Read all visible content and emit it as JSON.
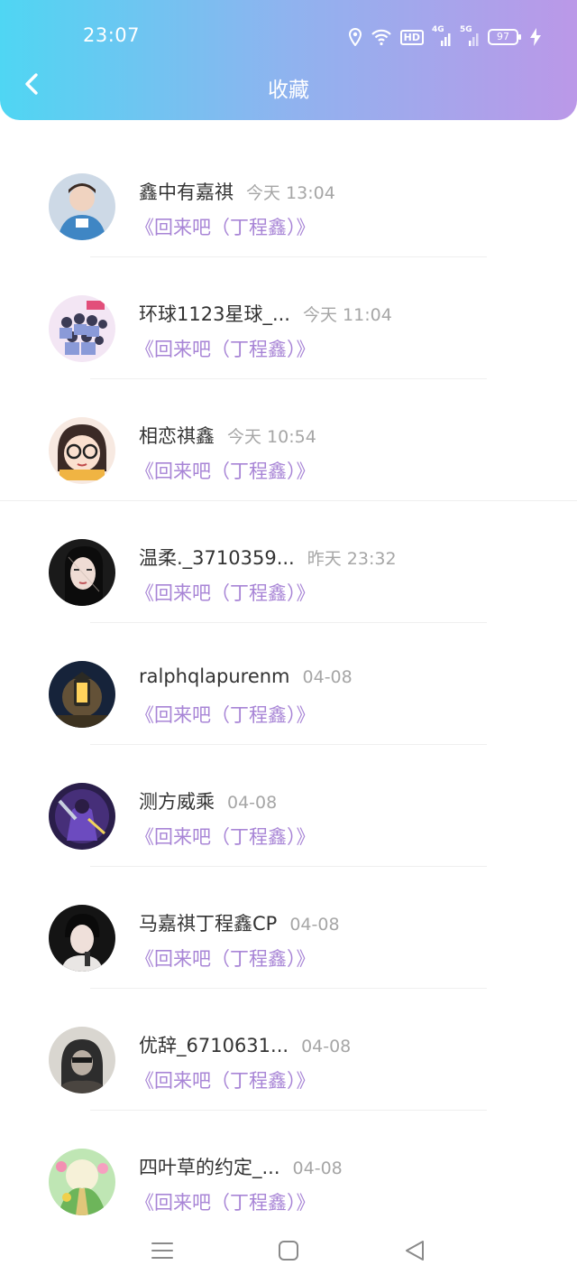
{
  "status_bar": {
    "time": "23:07",
    "hd_label": "HD",
    "net1_label": "4G",
    "net2_label": "5G",
    "battery": "97",
    "icons": [
      "location-icon",
      "wifi-icon",
      "hd-icon",
      "signal-icon",
      "signal-icon",
      "battery-icon",
      "charging-icon"
    ]
  },
  "header": {
    "title": "收藏",
    "back_icon": "chevron-left-icon",
    "gradient": [
      "#4fd6f3",
      "#bb98e8"
    ]
  },
  "accent_color": "#a885d6",
  "items": [
    {
      "name": "鑫中有嘉祺",
      "time": "今天 13:04",
      "work": "《回来吧（丁程鑫）》"
    },
    {
      "name": "环球1123星球_...",
      "time": "今天 11:04",
      "work": "《回来吧（丁程鑫）》"
    },
    {
      "name": "相恋祺鑫",
      "time": "今天 10:54",
      "work": "《回来吧（丁程鑫）》"
    },
    {
      "name": "温柔._3710359...",
      "time": "昨天 23:32",
      "work": "《回来吧（丁程鑫）》"
    },
    {
      "name": "ralphqlapurenm",
      "time": "04-08",
      "work": "《回来吧（丁程鑫）》"
    },
    {
      "name": "测方威乘",
      "time": "04-08",
      "work": "《回来吧（丁程鑫）》"
    },
    {
      "name": "马嘉祺丁程鑫CP",
      "time": "04-08",
      "work": "《回来吧（丁程鑫）》"
    },
    {
      "name": "优辞_6710631...",
      "time": "04-08",
      "work": "《回来吧（丁程鑫）》"
    },
    {
      "name": "四叶草的约定_...",
      "time": "04-08",
      "work": "《回来吧（丁程鑫）》"
    }
  ],
  "nav_bar": {
    "icons": [
      "menu-icon",
      "home-square-icon",
      "back-triangle-icon"
    ]
  }
}
